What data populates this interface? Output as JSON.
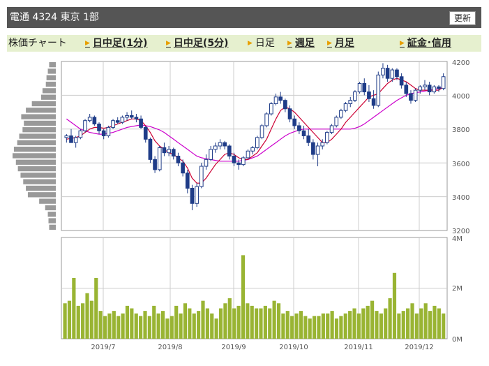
{
  "header": {
    "title": "電通  4324  東京 1部",
    "refresh_label": "更新"
  },
  "tabs": [
    {
      "label": "株価チャート",
      "link": false,
      "arrow": false
    },
    {
      "label": "日中足(1分)",
      "link": true,
      "arrow": true
    },
    {
      "label": "日中足(5分)",
      "link": true,
      "arrow": true
    },
    {
      "label": "日足",
      "link": false,
      "arrow": true
    },
    {
      "label": "週足",
      "link": true,
      "arrow": true
    },
    {
      "label": "月足",
      "link": true,
      "arrow": true
    },
    {
      "label": "証金･信用",
      "link": true,
      "arrow": true
    }
  ],
  "colors": {
    "candle_up": "#ffffff",
    "candle_down": "#1f3c88",
    "ma_short": "#cc0033",
    "ma_long": "#cc00cc",
    "volume": "#99b433",
    "volume_profile": "#999999",
    "grid": "#cccccc",
    "header_bg": "#555555",
    "tab_bg": "#e6f0cf"
  },
  "chart_data": [
    {
      "type": "candlestick",
      "price_ticks": [
        "4200",
        "4000",
        "3800",
        "3600",
        "3400",
        "3200"
      ],
      "ylim": [
        3200,
        4200
      ],
      "date_ticks": [
        "2019/7",
        "2019/8",
        "2019/9",
        "2019/10",
        "2019/11",
        "2019/12"
      ],
      "ohlc": [
        [
          3750,
          3770,
          3720,
          3760
        ],
        [
          3760,
          3800,
          3750,
          3720
        ],
        [
          3720,
          3760,
          3690,
          3750
        ],
        [
          3750,
          3800,
          3740,
          3790
        ],
        [
          3790,
          3860,
          3780,
          3850
        ],
        [
          3850,
          3890,
          3840,
          3870
        ],
        [
          3870,
          3880,
          3820,
          3830
        ],
        [
          3830,
          3840,
          3770,
          3790
        ],
        [
          3790,
          3800,
          3740,
          3760
        ],
        [
          3760,
          3820,
          3750,
          3810
        ],
        [
          3810,
          3860,
          3800,
          3850
        ],
        [
          3850,
          3870,
          3830,
          3840
        ],
        [
          3840,
          3880,
          3830,
          3870
        ],
        [
          3870,
          3900,
          3850,
          3880
        ],
        [
          3880,
          3910,
          3860,
          3870
        ],
        [
          3870,
          3890,
          3840,
          3860
        ],
        [
          3860,
          3880,
          3800,
          3810
        ],
        [
          3810,
          3820,
          3720,
          3740
        ],
        [
          3740,
          3750,
          3600,
          3620
        ],
        [
          3620,
          3640,
          3540,
          3560
        ],
        [
          3560,
          3700,
          3550,
          3690
        ],
        [
          3690,
          3720,
          3640,
          3660
        ],
        [
          3660,
          3700,
          3640,
          3680
        ],
        [
          3680,
          3690,
          3620,
          3640
        ],
        [
          3640,
          3660,
          3580,
          3600
        ],
        [
          3600,
          3620,
          3520,
          3540
        ],
        [
          3540,
          3560,
          3420,
          3450
        ],
        [
          3450,
          3470,
          3320,
          3360
        ],
        [
          3360,
          3480,
          3340,
          3460
        ],
        [
          3460,
          3600,
          3450,
          3580
        ],
        [
          3580,
          3650,
          3560,
          3620
        ],
        [
          3620,
          3700,
          3610,
          3680
        ],
        [
          3680,
          3720,
          3660,
          3700
        ],
        [
          3700,
          3740,
          3680,
          3720
        ],
        [
          3720,
          3730,
          3680,
          3700
        ],
        [
          3700,
          3710,
          3620,
          3640
        ],
        [
          3640,
          3660,
          3580,
          3600
        ],
        [
          3600,
          3620,
          3560,
          3590
        ],
        [
          3590,
          3640,
          3580,
          3630
        ],
        [
          3630,
          3680,
          3620,
          3670
        ],
        [
          3670,
          3700,
          3650,
          3690
        ],
        [
          3690,
          3760,
          3680,
          3750
        ],
        [
          3750,
          3830,
          3740,
          3820
        ],
        [
          3820,
          3900,
          3810,
          3890
        ],
        [
          3890,
          3960,
          3880,
          3950
        ],
        [
          3950,
          4010,
          3940,
          3990
        ],
        [
          3990,
          4020,
          3950,
          3970
        ],
        [
          3970,
          3980,
          3900,
          3920
        ],
        [
          3920,
          3940,
          3840,
          3860
        ],
        [
          3860,
          3880,
          3800,
          3820
        ],
        [
          3820,
          3840,
          3770,
          3790
        ],
        [
          3790,
          3820,
          3740,
          3760
        ],
        [
          3760,
          3800,
          3700,
          3720
        ],
        [
          3720,
          3740,
          3620,
          3650
        ],
        [
          3650,
          3720,
          3580,
          3700
        ],
        [
          3700,
          3740,
          3680,
          3720
        ],
        [
          3720,
          3790,
          3710,
          3780
        ],
        [
          3780,
          3830,
          3770,
          3820
        ],
        [
          3820,
          3880,
          3810,
          3870
        ],
        [
          3870,
          3920,
          3860,
          3910
        ],
        [
          3910,
          3960,
          3900,
          3950
        ],
        [
          3950,
          3990,
          3930,
          3970
        ],
        [
          3970,
          4030,
          3960,
          4020
        ],
        [
          4020,
          4080,
          4010,
          4070
        ],
        [
          4070,
          4100,
          4000,
          4020
        ],
        [
          4020,
          4060,
          3960,
          3980
        ],
        [
          3980,
          4030,
          3920,
          3940
        ],
        [
          3940,
          4140,
          3930,
          4120
        ],
        [
          4120,
          4190,
          4100,
          4160
        ],
        [
          4160,
          4180,
          4080,
          4100
        ],
        [
          4100,
          4160,
          4080,
          4150
        ],
        [
          4150,
          4160,
          4090,
          4110
        ],
        [
          4110,
          4130,
          4040,
          4060
        ],
        [
          4060,
          4080,
          3990,
          4010
        ],
        [
          4010,
          4030,
          3950,
          3970
        ],
        [
          3970,
          4040,
          3960,
          4030
        ],
        [
          4030,
          4060,
          4010,
          4050
        ],
        [
          4050,
          4090,
          4030,
          4060
        ],
        [
          4060,
          4080,
          4000,
          4020
        ],
        [
          4020,
          4060,
          4010,
          4050
        ],
        [
          4050,
          4060,
          4020,
          4040
        ],
        [
          4040,
          4130,
          4030,
          4110
        ]
      ],
      "ma_short": [
        3740,
        3745,
        3750,
        3760,
        3780,
        3800,
        3810,
        3810,
        3805,
        3810,
        3820,
        3830,
        3840,
        3850,
        3860,
        3860,
        3850,
        3820,
        3780,
        3730,
        3700,
        3680,
        3660,
        3650,
        3630,
        3610,
        3570,
        3510,
        3480,
        3480,
        3510,
        3550,
        3590,
        3620,
        3650,
        3660,
        3650,
        3630,
        3620,
        3620,
        3640,
        3660,
        3700,
        3740,
        3800,
        3860,
        3910,
        3930,
        3920,
        3900,
        3870,
        3840,
        3810,
        3780,
        3750,
        3720,
        3720,
        3740,
        3770,
        3800,
        3840,
        3870,
        3900,
        3930,
        3960,
        3990,
        4000,
        4010,
        4040,
        4070,
        4090,
        4100,
        4090,
        4080,
        4060,
        4040,
        4030,
        4030,
        4030,
        4030,
        4030,
        4050
      ],
      "ma_long": [
        3860,
        3840,
        3820,
        3800,
        3790,
        3780,
        3775,
        3770,
        3770,
        3775,
        3780,
        3790,
        3800,
        3810,
        3815,
        3820,
        3825,
        3820,
        3815,
        3805,
        3795,
        3780,
        3760,
        3740,
        3720,
        3700,
        3680,
        3660,
        3640,
        3630,
        3625,
        3620,
        3615,
        3610,
        3610,
        3610,
        3610,
        3610,
        3615,
        3620,
        3630,
        3640,
        3660,
        3680,
        3700,
        3720,
        3740,
        3760,
        3775,
        3785,
        3795,
        3800,
        3800,
        3800,
        3800,
        3800,
        3800,
        3800,
        3800,
        3800,
        3800,
        3800,
        3805,
        3815,
        3830,
        3850,
        3870,
        3890,
        3910,
        3930,
        3950,
        3970,
        3985,
        4000,
        4010,
        4015,
        4020,
        4025,
        4030,
        4035,
        4040,
        4045
      ],
      "volume_profile": [
        1.0,
        1.2,
        1.4,
        1.5,
        2.0,
        2.2,
        3.6,
        4.5,
        5.2,
        4.8,
        5.0,
        5.5,
        5.8,
        6.3,
        6.5,
        6.0,
        5.7,
        5.3,
        4.9,
        4.5,
        4.2,
        2.5,
        1.6,
        1.2,
        1.1,
        1.0
      ],
      "volume_ticks": [
        "4M",
        "2M",
        "0M"
      ],
      "volume_max_M": 4,
      "volume_M": [
        1.4,
        1.5,
        2.4,
        1.3,
        1.4,
        1.8,
        1.5,
        2.4,
        1.1,
        0.9,
        1.0,
        1.1,
        0.9,
        1.0,
        1.3,
        1.2,
        1.0,
        0.9,
        1.1,
        0.9,
        1.3,
        1.0,
        1.1,
        0.8,
        0.9,
        1.3,
        1.0,
        1.4,
        1.2,
        1.0,
        1.1,
        1.5,
        1.2,
        1.0,
        0.8,
        1.2,
        1.4,
        1.6,
        1.2,
        1.3,
        3.3,
        1.4,
        1.3,
        1.2,
        1.2,
        1.3,
        1.2,
        1.5,
        1.4,
        1.0,
        1.1,
        0.9,
        1.0,
        1.1,
        0.9,
        0.8,
        0.9,
        0.9,
        1.0,
        1.0,
        1.1,
        0.8,
        0.9,
        1.0,
        1.1,
        1.2,
        1.0,
        1.2,
        1.3,
        1.5,
        1.1,
        1.0,
        1.2,
        1.6,
        2.6,
        1.0,
        1.1,
        1.2,
        1.4,
        1.0,
        1.2,
        1.4,
        1.1,
        1.3,
        1.2,
        1.0
      ]
    }
  ]
}
